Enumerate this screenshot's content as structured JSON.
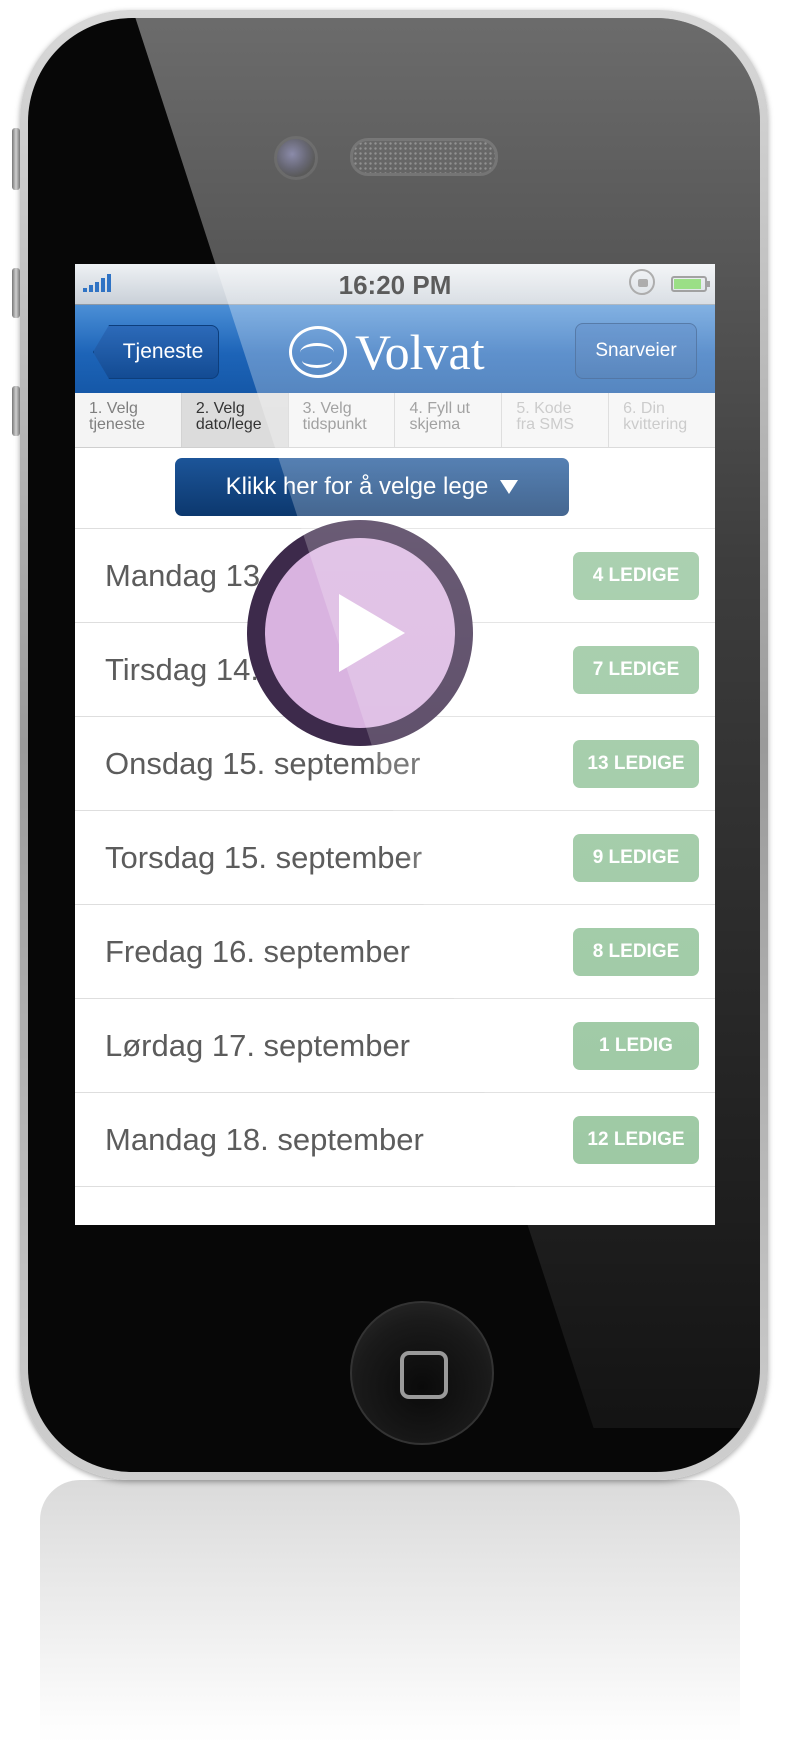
{
  "status_bar": {
    "time": "16:20 PM"
  },
  "nav": {
    "back_label": "Tjeneste",
    "logo_text": "Volvat",
    "shortcut_label": "Snarveier"
  },
  "steps": [
    {
      "line1": "1. Velg",
      "line2": "tjeneste",
      "state": "done"
    },
    {
      "line1": "2. Velg",
      "line2": "dato/lege",
      "state": "active"
    },
    {
      "line1": "3. Velg",
      "line2": "tidspunkt",
      "state": "done"
    },
    {
      "line1": "4. Fyll ut",
      "line2": "skjema",
      "state": "done"
    },
    {
      "line1": "5. Kode",
      "line2": "fra SMS",
      "state": "dim"
    },
    {
      "line1": "6. Din",
      "line2": "kvittering",
      "state": "dim"
    }
  ],
  "picker": {
    "label": "Klikk her for å velge lege"
  },
  "days": [
    {
      "label": "Mandag 13. september",
      "badge": "4 LEDIGE"
    },
    {
      "label": "Tirsdag 14. september",
      "badge": "7 LEDIGE"
    },
    {
      "label": "Onsdag 15. september",
      "badge": "13 LEDIGE"
    },
    {
      "label": "Torsdag 15. september",
      "badge": "9 LEDIGE"
    },
    {
      "label": "Fredag 16. september",
      "badge": "8 LEDIGE"
    },
    {
      "label": "Lørdag 17. september",
      "badge": "1 LEDIG"
    },
    {
      "label": "Mandag 18. september",
      "badge": "12 LEDIGE"
    }
  ],
  "colors": {
    "nav_blue": "#1d64b8",
    "picker_navy": "#0c386e",
    "badge_green": "#93c39a",
    "play_ring": "#3d2a4b",
    "play_fill": "#d9b3e0"
  },
  "icons": {
    "play": "play-icon",
    "home": "home-button-icon",
    "battery": "battery-icon",
    "signal": "signal-icon",
    "rotation_lock": "rotation-lock-icon",
    "dropdown": "chevron-down-icon"
  }
}
